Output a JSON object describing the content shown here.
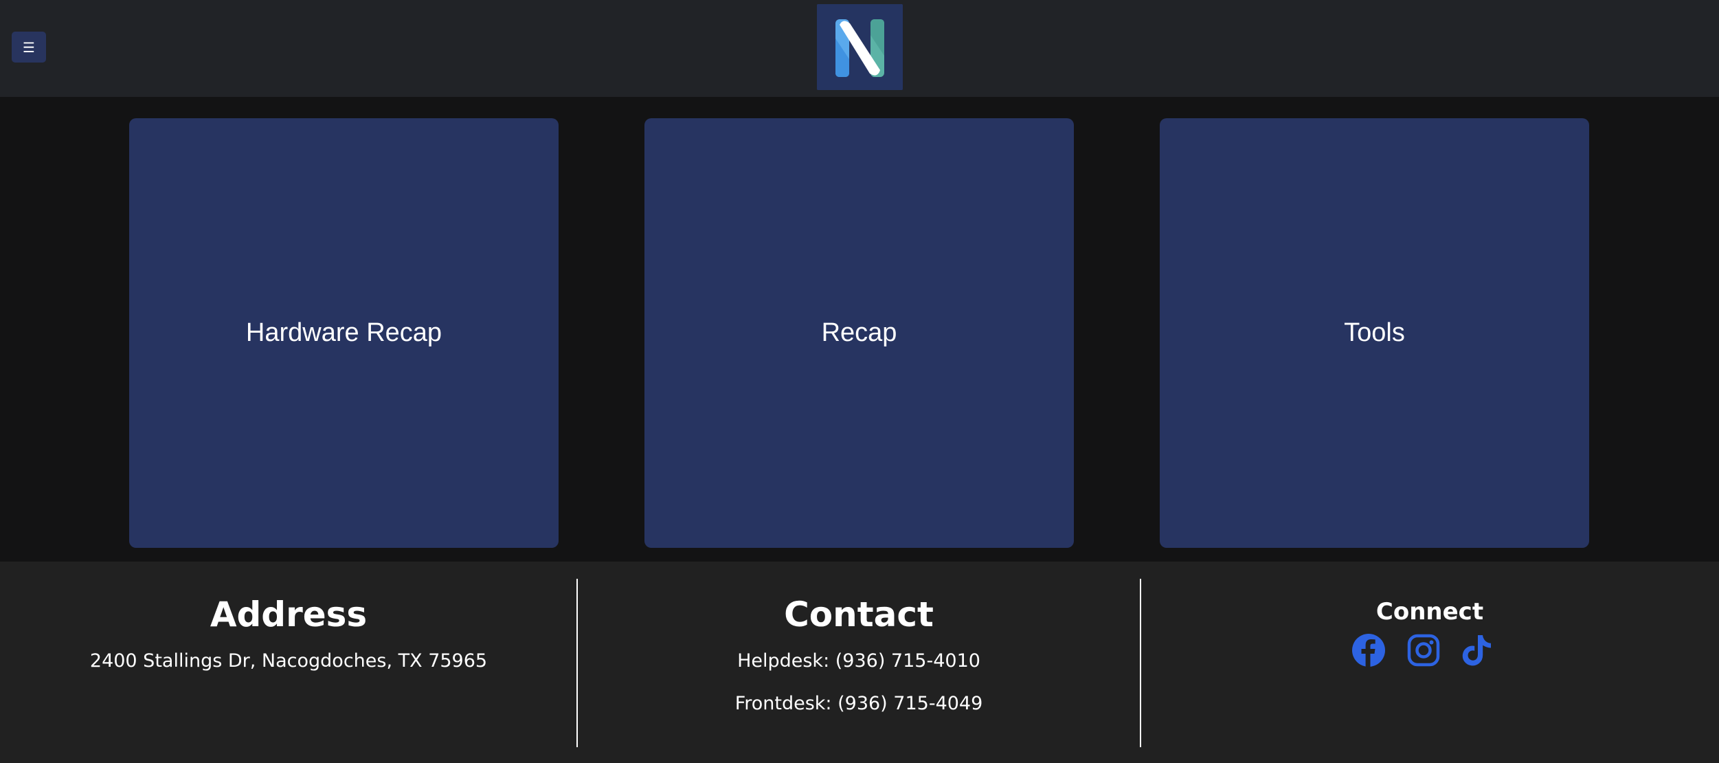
{
  "header": {
    "menu_icon": "☰",
    "logo_icon": "n-logo-icon"
  },
  "cards": [
    {
      "label": "Hardware Recap"
    },
    {
      "label": "Recap"
    },
    {
      "label": "Tools"
    }
  ],
  "footer": {
    "address": {
      "title": "Address",
      "text": "2400 Stallings Dr, Nacogdoches, TX 75965"
    },
    "contact": {
      "title": "Contact",
      "helpdesk": "Helpdesk: (936) 715-4010",
      "frontdesk": "Frontdesk: (936) 715-4049"
    },
    "connect": {
      "title": "Connect",
      "icons": [
        "facebook-icon",
        "instagram-icon",
        "tiktok-icon"
      ]
    }
  },
  "colors": {
    "header_bg": "#212327",
    "page_bg": "#131314",
    "card_bg": "#273461",
    "footer_bg": "#212121",
    "social_blue": "#2d63e2"
  }
}
